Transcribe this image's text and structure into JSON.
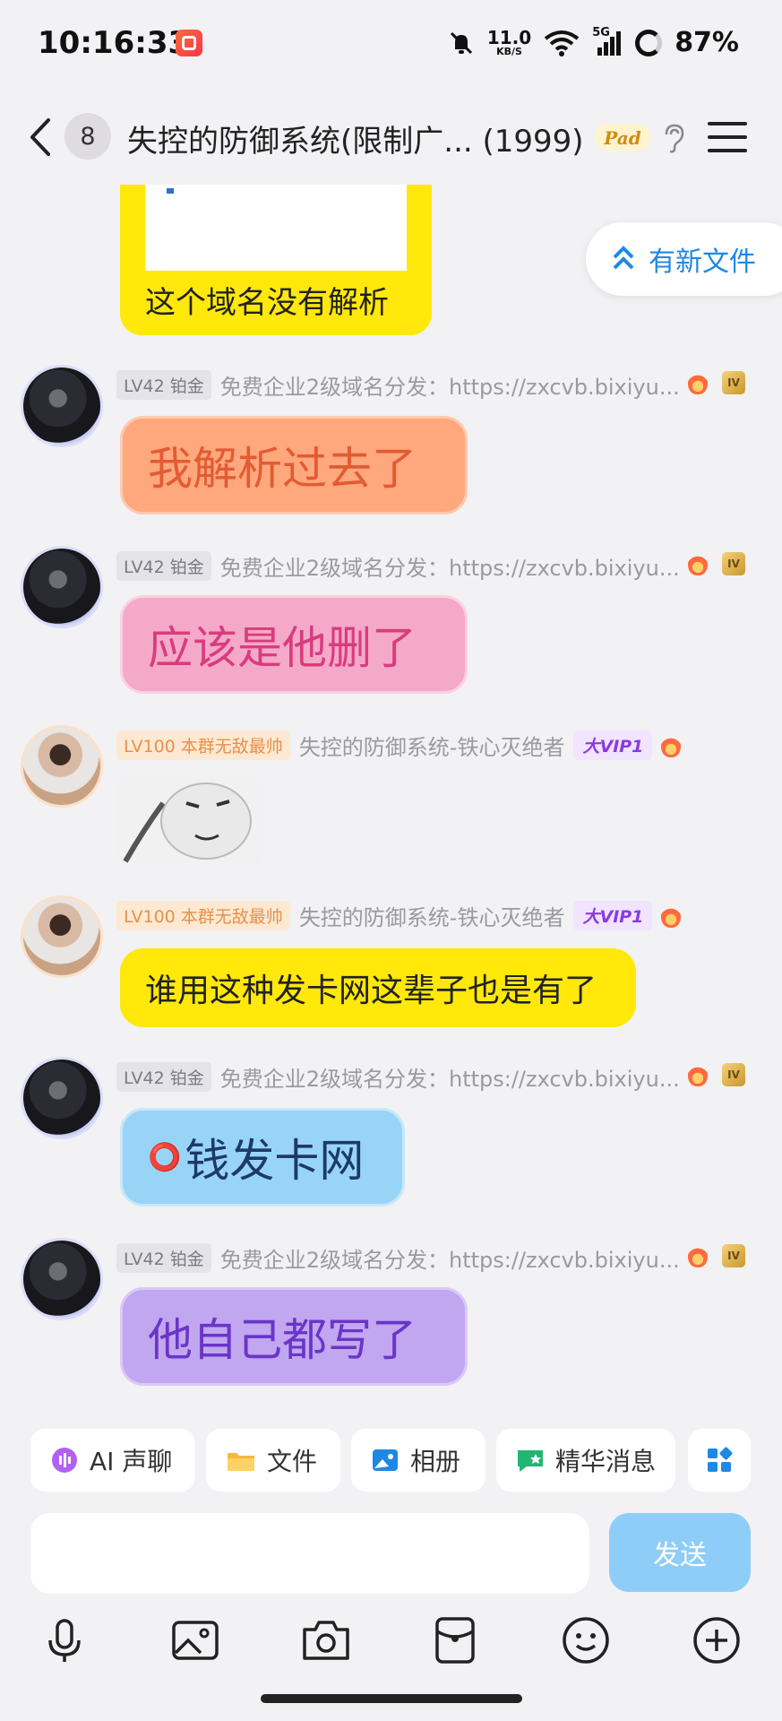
{
  "status_bar": {
    "time": "10:16:33",
    "net_speed_value": "11.0",
    "net_speed_unit": "KB/S",
    "network": "5G",
    "battery": "87%",
    "icons": [
      "app-notification-icon",
      "mute-bell-icon",
      "wifi-icon",
      "signal-icon",
      "battery-ring-icon"
    ]
  },
  "header": {
    "unread_count": "8",
    "title": "失控的防御系统(限制广... (1999)",
    "badge_text": "Pad",
    "icons": [
      "back-arrow-icon",
      "pad-badge-icon",
      "ear-icon",
      "menu-icon"
    ]
  },
  "new_file_button": {
    "label": "有新文件",
    "icon": "double-chevron-up-icon"
  },
  "messages": [
    {
      "partial_bubble_text": "这个域名没有解析"
    },
    {
      "level": "LV42 铂金",
      "sender": "免费企业2级域名分发：https://zxcvb.bixiyu...",
      "text": "我解析过去了",
      "style": "orange"
    },
    {
      "level": "LV42 铂金",
      "sender": "免费企业2级域名分发：https://zxcvb.bixiyu...",
      "text": "应该是他删了",
      "style": "pink"
    },
    {
      "level": "LV100 本群无敌最帅",
      "sender": "失控的防御系统-铁心灭绝者",
      "vip": "大VIP1",
      "type": "sticker"
    },
    {
      "level": "LV100 本群无敌最帅",
      "sender": "失控的防御系统-铁心灭绝者",
      "vip": "大VIP1",
      "text": "谁用这种发卡网这辈子也是有了",
      "style": "yellow"
    },
    {
      "level": "LV42 铂金",
      "sender": "免费企业2级域名分发：https://zxcvb.bixiyu...",
      "text": "钱发卡网",
      "prefix": "⭕",
      "style": "blue"
    },
    {
      "level": "LV42 铂金",
      "sender": "免费企业2级域名分发：https://zxcvb.bixiyu...",
      "text": "他自己都写了",
      "style": "purple"
    }
  ],
  "quick_actions": [
    {
      "label": "AI 声聊",
      "icon": "ai-voice-icon"
    },
    {
      "label": "文件",
      "icon": "folder-icon"
    },
    {
      "label": "相册",
      "icon": "album-icon"
    },
    {
      "label": "精华消息",
      "icon": "highlight-icon"
    },
    {
      "label": "",
      "icon": "apps-grid-icon"
    }
  ],
  "composer": {
    "placeholder": "",
    "send_label": "发送"
  },
  "bottom_icons": [
    "microphone-icon",
    "image-icon",
    "camera-icon",
    "red-packet-icon",
    "emoji-icon",
    "plus-icon"
  ]
}
